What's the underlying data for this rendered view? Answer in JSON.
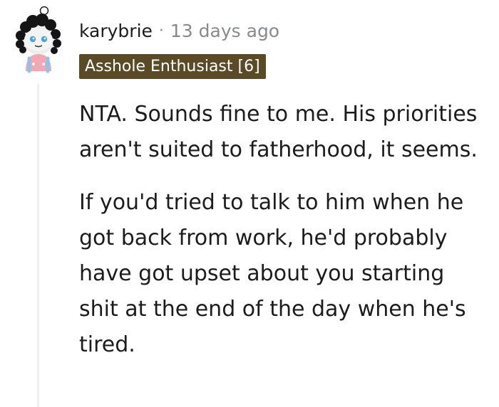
{
  "comment": {
    "author": "karybrie",
    "separator": "·",
    "timestamp": "13 days ago",
    "flair": "Asshole Enthusiast [6]",
    "flair_color": "#5b4a26",
    "avatar_icon": "snoo-avatar-icon",
    "paragraphs": [
      "NTA. Sounds fine to me. His priorities aren't suited to fatherhood, it seems.",
      "If you'd tried to talk to him when he got back from work, he'd probably have got upset about you starting shit at the end of the day when he's tired."
    ]
  }
}
